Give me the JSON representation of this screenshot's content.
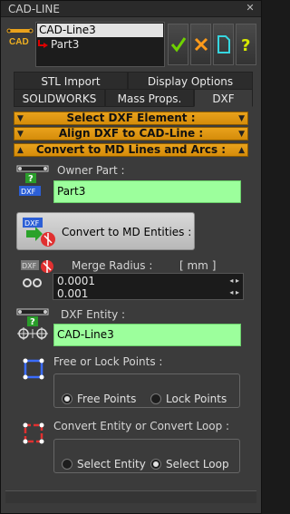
{
  "window": {
    "title": "CAD-LINE"
  },
  "logo": {
    "text": "CAD"
  },
  "tree": {
    "root": "CAD-Line3",
    "child": "Part3"
  },
  "tabs": {
    "row1": [
      "STL Import",
      "Display Options"
    ],
    "row2": [
      "SOLIDWORKS",
      "Mass Props.",
      "DXF"
    ],
    "active": "DXF"
  },
  "sections": {
    "select": "Select DXF Element :",
    "align": "Align DXF to CAD-Line :",
    "convert": "Convert to MD Lines and Arcs :"
  },
  "owner": {
    "label": "Owner Part :",
    "value": "Part3",
    "badge": "DXF"
  },
  "convert_button": {
    "label": "Convert to MD Entities :",
    "badge": "DXF"
  },
  "merge": {
    "label": "Merge Radius :",
    "unit": "[ mm ]",
    "value": "0.0001",
    "step": "0.001",
    "badge": "DXF"
  },
  "dxf_entity": {
    "label": "DXF Entity :",
    "value": "CAD-Line3"
  },
  "free_lock": {
    "label": "Free or Lock Points :",
    "options": [
      "Free Points",
      "Lock Points"
    ],
    "selected": "Free Points"
  },
  "entity_loop": {
    "label": "Convert Entity or Convert Loop :",
    "options": [
      "Select Entity",
      "Select Loop"
    ],
    "selected": "Select Loop"
  },
  "colors": {
    "accent": "#e9a21c",
    "field": "#9cff9c",
    "check": "#6fd200",
    "close": "#ff9a1a"
  }
}
